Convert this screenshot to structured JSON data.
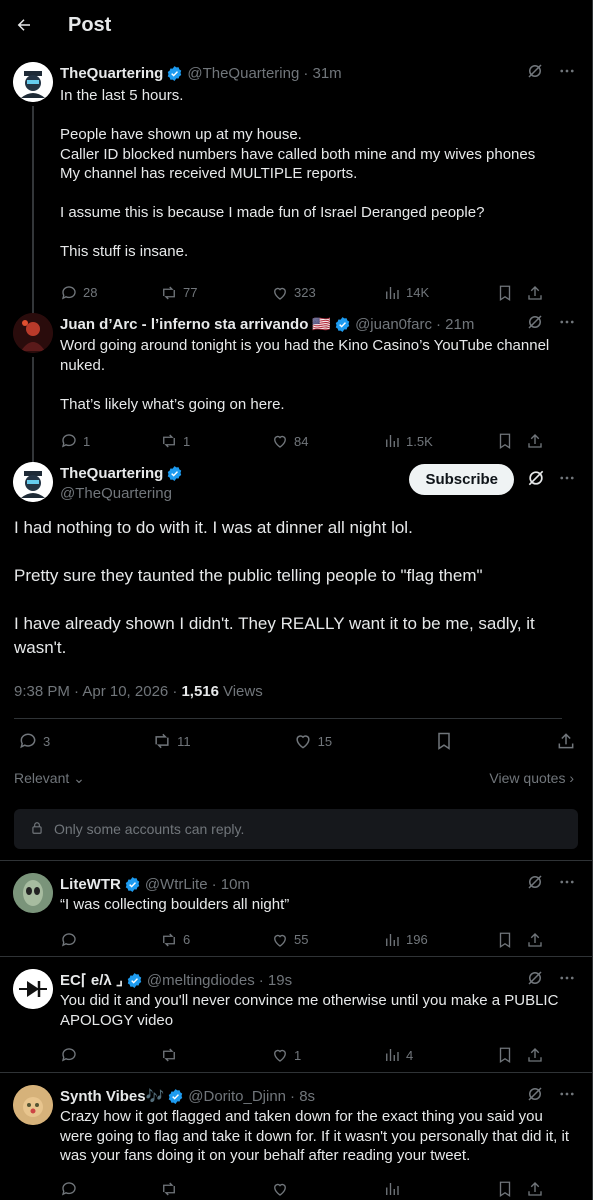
{
  "header": {
    "title": "Post"
  },
  "thread": [
    {
      "name": "TheQuartering",
      "handle": "@TheQuartering",
      "time": "· 31m",
      "text": "In the last 5 hours.\n\nPeople have shown up at my house.\nCaller ID blocked numbers have called both mine and my wives phones\nMy channel has received MULTIPLE reports.\n\nI assume this is because I made fun of Israel Deranged people?\n\nThis stuff is insane.",
      "replies": "28",
      "reposts": "77",
      "likes": "323",
      "views": "14K"
    },
    {
      "name": "Juan d’Arc - l’inferno sta arrivando",
      "flag": "🇺🇸",
      "handle": "@juan0farc",
      "time": "· 21m",
      "text": "Word going around tonight is you had the Kino Casino’s YouTube channel nuked.\n\nThat’s likely what’s going on here.",
      "replies": "1",
      "reposts": "1",
      "likes": "84",
      "views": "1.5K"
    }
  ],
  "main": {
    "name": "TheQuartering",
    "handle": "@TheQuartering",
    "subscribe_label": "Subscribe",
    "text": "I had nothing to do with it.  I was at dinner all night lol.\n\nPretty sure they taunted the public telling people to \"flag them\"\n\nI have already shown I didn't.  They REALLY want it to be me, sadly, it wasn't.",
    "timestamp": "9:38 PM · Apr 10, 2026 ·",
    "views_count": "1,516",
    "views_label": "Views",
    "replies": "3",
    "reposts": "11",
    "likes": "15",
    "sort_label": "Relevant",
    "view_quotes": "View quotes",
    "reply_restriction": "Only some accounts can reply."
  },
  "replies": [
    {
      "name": "LiteWTR",
      "handle": "@WtrLite",
      "time": "· 10m",
      "text": "“I was collecting boulders all night”",
      "replies": "",
      "reposts": "6",
      "likes": "55",
      "views": "196"
    },
    {
      "name": "EC⌈ e/λ ⌟",
      "handle": "@meltingdiodes",
      "time": "· 19s",
      "text": "You did it and you'll never convince me otherwise until you make a PUBLIC APOLOGY video",
      "replies": "",
      "reposts": "",
      "likes": "1",
      "views": "4"
    },
    {
      "name": "Synth Vibes🎶",
      "handle": "@Dorito_Djinn",
      "time": "· 8s",
      "text": "Crazy how it got flagged and taken down for the exact thing you said you were going to flag and take it down for. If it wasn't you personally that did it, it was your fans doing it on your behalf after reading your tweet.",
      "replies": "",
      "reposts": "",
      "likes": "",
      "views": ""
    }
  ],
  "colors": {
    "accent": "#1d9bf0",
    "muted": "#71767b",
    "border": "#2f3336",
    "background": "#000000"
  }
}
